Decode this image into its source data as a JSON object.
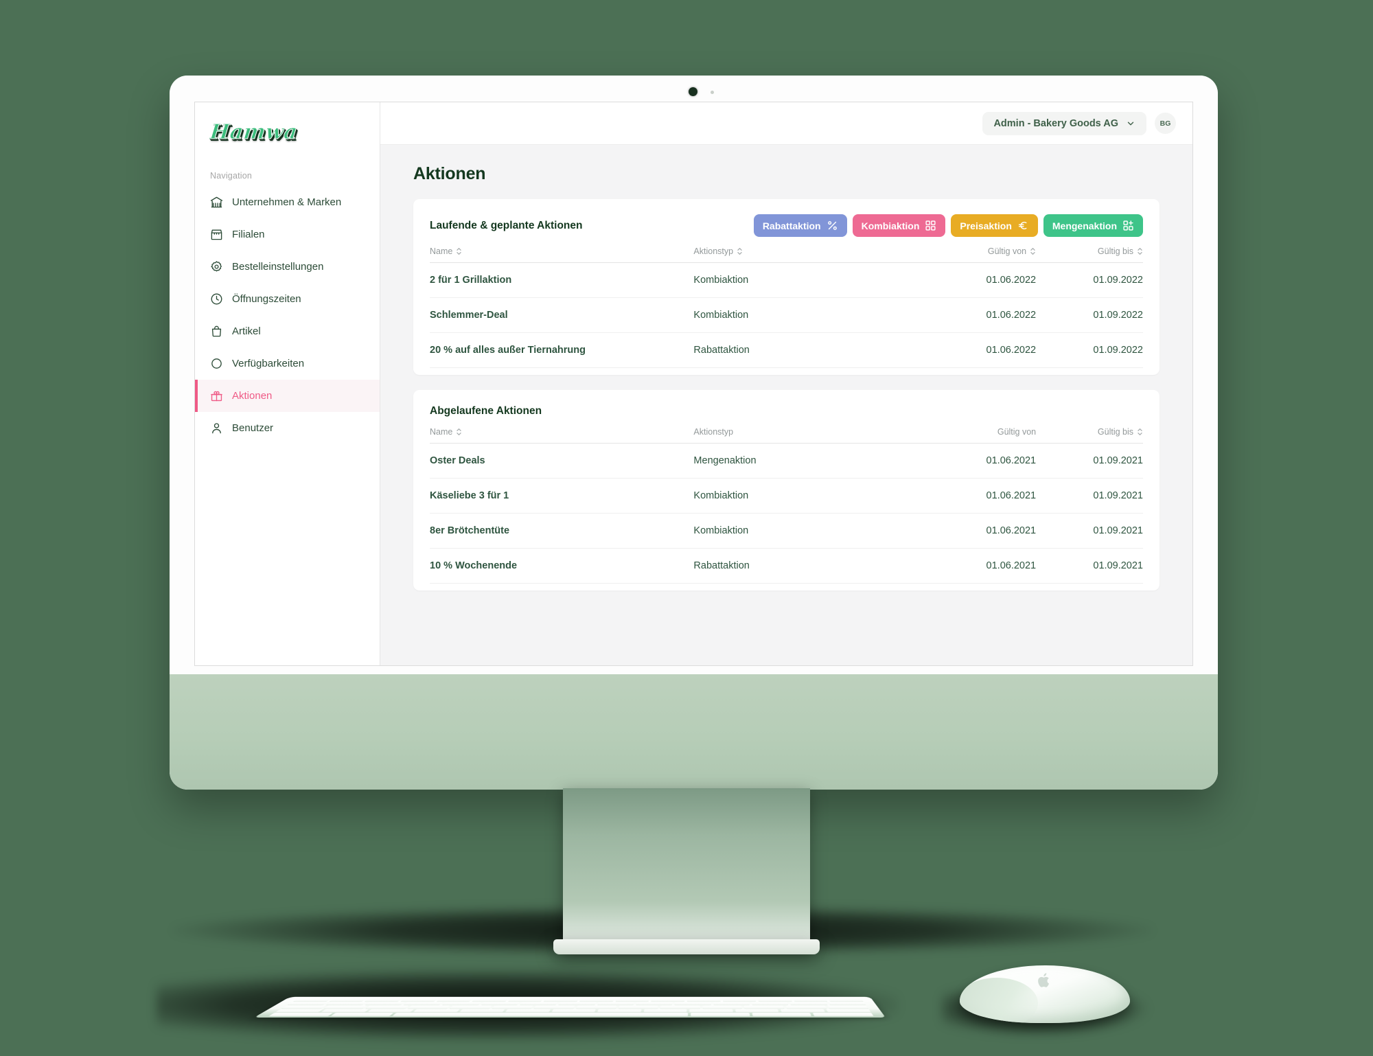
{
  "brand": {
    "logo_text": "Hamwa"
  },
  "sidebar": {
    "section_label": "Navigation",
    "items": [
      {
        "label": "Unternehmen & Marken",
        "icon": "bank-icon",
        "active": false
      },
      {
        "label": "Filialen",
        "icon": "store-icon",
        "active": false
      },
      {
        "label": "Bestelleinstellungen",
        "icon": "gear-icon",
        "active": false
      },
      {
        "label": "Öffnungszeiten",
        "icon": "clock-icon",
        "active": false
      },
      {
        "label": "Artikel",
        "icon": "bag-icon",
        "active": false
      },
      {
        "label": "Verfügbarkeiten",
        "icon": "circle-icon",
        "active": false
      },
      {
        "label": "Aktionen",
        "icon": "gift-icon",
        "active": true
      },
      {
        "label": "Benutzer",
        "icon": "user-icon",
        "active": false
      }
    ]
  },
  "topbar": {
    "org_switcher_label": "Admin - Bakery Goods AG",
    "avatar_initials": "BG"
  },
  "page": {
    "title": "Aktionen"
  },
  "chips": [
    {
      "label": "Rabattaktion",
      "icon": "percent-icon",
      "color": "#8195d8"
    },
    {
      "label": "Kombiaktion",
      "icon": "grid-four-icon",
      "color": "#ee6a93"
    },
    {
      "label": "Preisaktion",
      "icon": "euro-icon",
      "color": "#e8ac24"
    },
    {
      "label": "Mengenaktion",
      "icon": "grid-plus-icon",
      "color": "#3ec489"
    }
  ],
  "tables": [
    {
      "title": "Laufende & geplante Aktionen",
      "columns": [
        {
          "label": "Name",
          "sortable": true
        },
        {
          "label": "Aktionstyp",
          "sortable": true
        },
        {
          "label": "Gültig von",
          "sortable": true
        },
        {
          "label": "Gültig bis",
          "sortable": true
        }
      ],
      "rows": [
        {
          "name": "2 für 1 Grillaktion",
          "type": "Kombiaktion",
          "from": "01.06.2022",
          "to": "01.09.2022"
        },
        {
          "name": "Schlemmer-Deal",
          "type": "Kombiaktion",
          "from": "01.06.2022",
          "to": "01.09.2022"
        },
        {
          "name": "20 % auf alles außer Tiernahrung",
          "type": "Rabattaktion",
          "from": "01.06.2022",
          "to": "01.09.2022"
        }
      ]
    },
    {
      "title": "Abgelaufene Aktionen",
      "columns": [
        {
          "label": "Name",
          "sortable": true
        },
        {
          "label": "Aktionstyp",
          "sortable": false
        },
        {
          "label": "Gültig von",
          "sortable": false
        },
        {
          "label": "Gültig bis",
          "sortable": true
        }
      ],
      "rows": [
        {
          "name": "Oster Deals",
          "type": "Mengenaktion",
          "from": "01.06.2021",
          "to": "01.09.2021"
        },
        {
          "name": "Käseliebe 3 für 1",
          "type": "Kombiaktion",
          "from": "01.06.2021",
          "to": "01.09.2021"
        },
        {
          "name": "8er Brötchentüte",
          "type": "Kombiaktion",
          "from": "01.06.2021",
          "to": "01.09.2021"
        },
        {
          "name": "10 % Wochenende",
          "type": "Rabattaktion",
          "from": "01.06.2021",
          "to": "01.09.2021"
        }
      ]
    }
  ],
  "colors": {
    "accent_pink": "#ef5a86",
    "dark_green": "#14381f",
    "chin_green": "#b6cdb7",
    "backdrop_green": "#4c7055"
  }
}
